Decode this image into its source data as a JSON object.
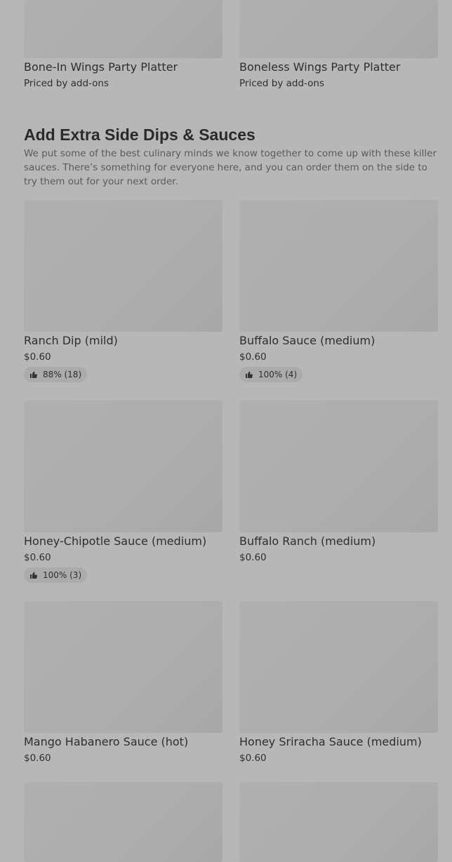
{
  "platters": [
    {
      "name": "Bone-In Wings Party Platter",
      "price": "Priced by add-ons"
    },
    {
      "name": "Boneless Wings Party Platter",
      "price": "Priced by add-ons"
    }
  ],
  "section": {
    "title": "Add Extra Side Dips & Sauces",
    "description": "We put some of the best culinary minds we know together to come up with these killer sauces. There’s something for everyone here, and you can order them on the side to try them out for your next order."
  },
  "items": [
    {
      "name": "Ranch Dip (mild)",
      "price": "$0.60",
      "rating": "88% (18)"
    },
    {
      "name": "Buffalo Sauce (medium)",
      "price": "$0.60",
      "rating": "100% (4)"
    },
    {
      "name": "Honey-Chipotle Sauce (medium)",
      "price": "$0.60",
      "rating": "100% (3)"
    },
    {
      "name": "Buffalo Ranch (medium)",
      "price": "$0.60"
    },
    {
      "name": "Mango Habanero Sauce (hot)",
      "price": "$0.60"
    },
    {
      "name": "Honey Sriracha Sauce (medium)",
      "price": "$0.60"
    }
  ],
  "icons": {
    "rating": "thumbs-up-icon"
  }
}
